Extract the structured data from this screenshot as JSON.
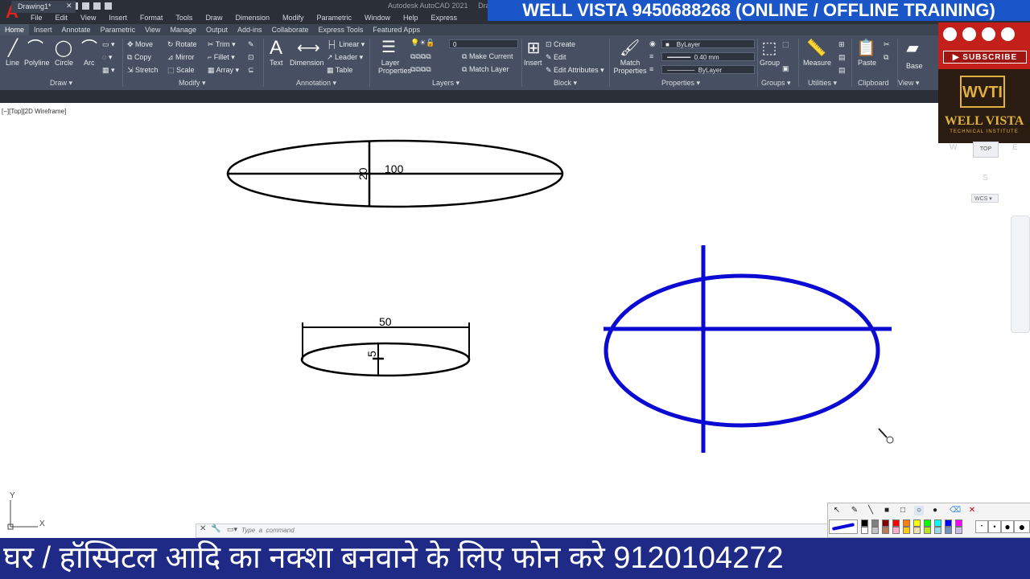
{
  "window": {
    "app_title": "Autodesk AutoCAD 2021",
    "title_suffix": "Draw"
  },
  "menus": [
    "File",
    "Edit",
    "View",
    "Insert",
    "Format",
    "Tools",
    "Draw",
    "Dimension",
    "Modify",
    "Parametric",
    "Window",
    "Help",
    "Express"
  ],
  "promo": {
    "text": "WELL VISTA  9450688268 (ONLINE / OFFLINE TRAINING)"
  },
  "ribbon": {
    "tabs": [
      "Home",
      "Insert",
      "Annotate",
      "Parametric",
      "View",
      "Manage",
      "Output",
      "Add-ins",
      "Collaborate",
      "Express Tools",
      "Featured Apps"
    ],
    "active_tab": "Home",
    "draw": {
      "panel": "Draw",
      "line": "Line",
      "polyline": "Polyline",
      "circle": "Circle",
      "arc": "Arc"
    },
    "modify": {
      "panel": "Modify",
      "move": "Move",
      "rotate": "Rotate",
      "trim": "Trim",
      "copy": "Copy",
      "mirror": "Mirror",
      "fillet": "Fillet",
      "stretch": "Stretch",
      "scale": "Scale",
      "array": "Array"
    },
    "annotation": {
      "panel": "Annotation",
      "text": "Text",
      "dimension": "Dimension",
      "linear": "Linear",
      "leader": "Leader",
      "table": "Table"
    },
    "layers": {
      "panel": "Layers",
      "layer_properties": "Layer Properties",
      "current_layer": "0",
      "make_current": "Make Current",
      "match_layer": "Match Layer"
    },
    "block": {
      "panel": "Block",
      "insert": "Insert",
      "create": "Create",
      "edit": "Edit",
      "edit_attributes": "Edit Attributes"
    },
    "properties": {
      "panel": "Properties",
      "match_properties": "Match Properties",
      "color": "ByLayer",
      "lineweight": "0.40 mm",
      "linetype": "ByLayer"
    },
    "groups": {
      "panel": "Groups",
      "group": "Group"
    },
    "utilities": {
      "panel": "Utilities",
      "measure": "Measure"
    },
    "clipboard": {
      "panel": "Clipboard",
      "paste": "Paste"
    },
    "view": {
      "panel": "View",
      "base": "Base"
    }
  },
  "document": {
    "tab": "Drawing1*",
    "close_glyph": "✕",
    "add_glyph": "+"
  },
  "viewport": {
    "label": "[−][Top][2D Wireframe]"
  },
  "drawing": {
    "dims": {
      "d100": "100",
      "d20": "20",
      "d50": "50",
      "d5": "5"
    },
    "blue_color": "#0a0ad2"
  },
  "viewcube": {
    "top": "TOP",
    "west": "W",
    "east": "E",
    "south": "S",
    "wcs": "WCS"
  },
  "ucs": {
    "x": "X",
    "y": "Y"
  },
  "command": {
    "placeholder": "Type  a  command"
  },
  "branding": {
    "subscribe": "▶ SUBSCRIBE",
    "logo_mark": "WVTI",
    "name": "WELL VISTA",
    "subtitle": "TECHNICAL INSTITUTE"
  },
  "annotate_tools": {
    "swatches": [
      "#000000",
      "#7f7f7f",
      "#7f0000",
      "#ff0000",
      "#ff7f00",
      "#ffff00",
      "#00ff00",
      "#00ffff",
      "#0000ff",
      "#ff00ff",
      "#ffffff",
      "#c3c3c3",
      "#b97a57",
      "#ffaec9",
      "#ffc90e",
      "#efe4b0",
      "#b5e61d",
      "#99d9ea",
      "#7092be",
      "#c8bfe7"
    ]
  },
  "ticker": {
    "text": "घर / हॉस्पिटल आदि का नक्शा बनवाने के लिए फोन करे 9120104272"
  }
}
